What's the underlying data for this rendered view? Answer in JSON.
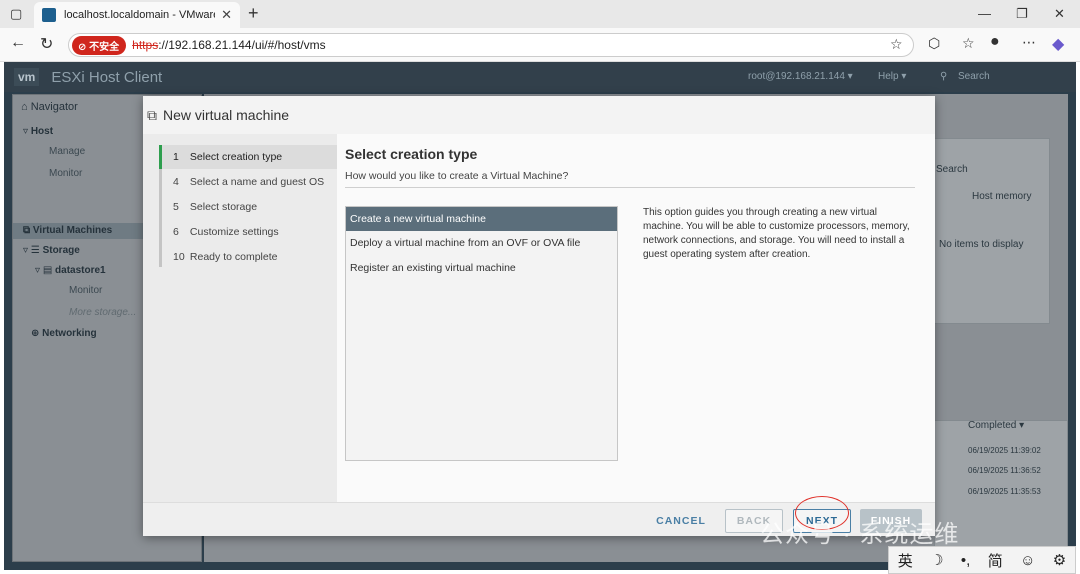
{
  "browser": {
    "tab_title": "localhost.localdomain - VMware E",
    "security_label": "不安全",
    "url_scheme": "https",
    "url_rest": "://192.168.21.144/ui/#/host/vms"
  },
  "esxi": {
    "logo": "vm",
    "title": "ESXi Host Client",
    "user": "root@192.168.21.144 ▾",
    "help": "Help ▾",
    "search": "Search"
  },
  "navigator": {
    "title": "Navigator",
    "items": [
      {
        "label": "Host"
      },
      {
        "label": "Manage"
      },
      {
        "label": "Monitor"
      },
      {
        "label": "Virtual Machines"
      },
      {
        "label": "Storage"
      },
      {
        "label": "datastore1"
      },
      {
        "label": "Monitor"
      },
      {
        "label": "More storage..."
      },
      {
        "label": "Networking"
      }
    ]
  },
  "background": {
    "search": "Search",
    "host_memory": "Host memory",
    "no_items": "No items to display",
    "completed": "Completed ▾",
    "dates": [
      "06/19/2025 11:39:02",
      "06/19/2025 11:36:52",
      "06/19/2025 11:35:53"
    ]
  },
  "wizard": {
    "title": "New virtual machine",
    "steps": [
      {
        "num": "1",
        "label": "Select creation type"
      },
      {
        "num": "4",
        "label": "Select a name and guest OS"
      },
      {
        "num": "5",
        "label": "Select storage"
      },
      {
        "num": "6",
        "label": "Customize settings"
      },
      {
        "num": "10",
        "label": "Ready to complete"
      }
    ],
    "heading": "Select creation type",
    "subheading": "How would you like to create a Virtual Machine?",
    "options": [
      "Create a new virtual machine",
      "Deploy a virtual machine from an OVF or OVA file",
      "Register an existing virtual machine"
    ],
    "description": "This option guides you through creating a new virtual machine. You will be able to customize processors, memory, network connections, and storage. You will need to install a guest operating system after creation.",
    "buttons": {
      "cancel": "CANCEL",
      "back": "BACK",
      "next": "NEXT",
      "finish": "FINISH"
    }
  },
  "watermark": "公众号 · 系统运维",
  "ime": [
    "英",
    "☽",
    "•,",
    "简",
    "☺",
    "⚙"
  ]
}
